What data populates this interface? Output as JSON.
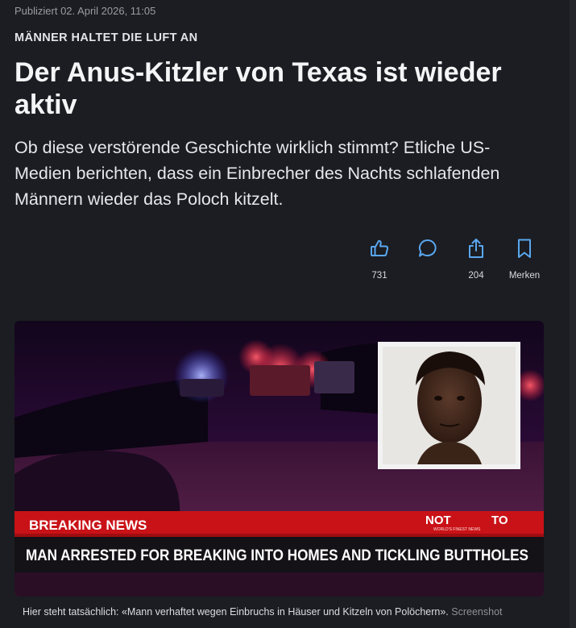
{
  "article": {
    "published": "Publiziert 02. April 2026, 11:05",
    "kicker": "MÄNNER HALTET DIE LUFT AN",
    "headline": "Der Anus-Kitzler von Texas ist wieder aktiv",
    "lead": "Ob diese verstörende Geschichte wirklich stimmt? Etliche US-Medien berichten, dass ein Einbrecher des Nachts schlafenden Männern wieder das Poloch kitzelt."
  },
  "actions": {
    "like": {
      "icon": "thumbs-up-icon",
      "count": "731"
    },
    "comment": {
      "icon": "speech-bubble-icon",
      "count": ""
    },
    "share": {
      "icon": "share-icon",
      "count": "204"
    },
    "bookmark": {
      "icon": "bookmark-icon",
      "label": "Merken"
    }
  },
  "image": {
    "banner_tag": "BREAKING NEWS",
    "banner_headline": "MAN ARRESTED FOR BREAKING INTO HOMES AND TICKLING BUTTHOLES",
    "logo_text_1": "NOT",
    "logo_text_2": "TO",
    "logo_subtext": "WORLD'S FINEST NEWS"
  },
  "caption": {
    "text": "Hier steht tatsächlich: «Mann verhaftet wegen Einbruchs in Häuser und Kitzeln von Polöchern».",
    "credit": "Screenshot"
  },
  "colors": {
    "background": "#1b1d22",
    "accent": "#5aa7f0",
    "banner_red": "#d3151a"
  }
}
